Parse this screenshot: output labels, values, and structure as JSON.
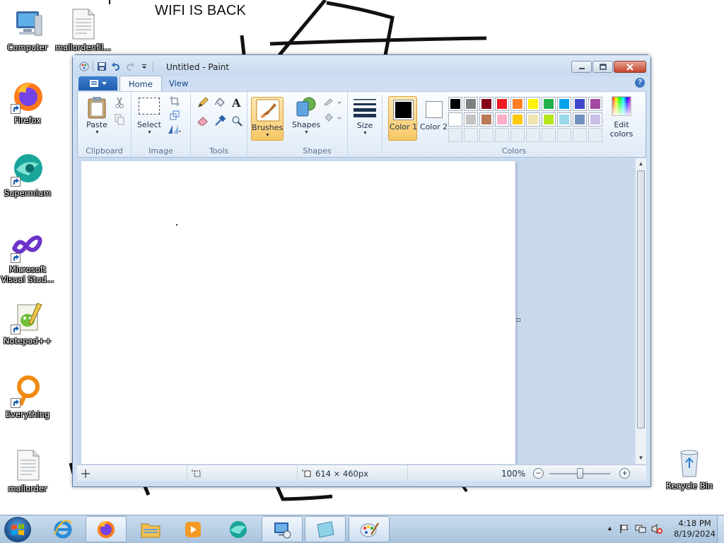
{
  "desktop": {
    "title_text": "WIFI IS BACK",
    "icons": [
      {
        "label": "Computer"
      },
      {
        "label": "mallordenfil..."
      },
      {
        "label": "Firefox"
      },
      {
        "label": "Supermium"
      },
      {
        "label": "Microsoft Visual Stud..."
      },
      {
        "label": "Notepad++"
      },
      {
        "label": "Everything"
      },
      {
        "label": "mallorder"
      },
      {
        "label": "Recycle Bin"
      }
    ]
  },
  "window": {
    "title": "Untitled - Paint",
    "tabs": [
      {
        "label": "Home",
        "active": true
      },
      {
        "label": "View",
        "active": false
      }
    ],
    "groups": {
      "clipboard": {
        "label": "Clipboard",
        "paste_label": "Paste"
      },
      "image": {
        "label": "Image",
        "select_label": "Select"
      },
      "tools": {
        "label": "Tools"
      },
      "brushes": {
        "label": "Brushes"
      },
      "shapes": {
        "label": "Shapes",
        "shapes_label": "Shapes"
      },
      "size": {
        "label": "Size"
      },
      "colors": {
        "label": "Colors",
        "color1_label": "Color 1",
        "color2_label": "Color 2",
        "edit_label": "Edit colors",
        "color1": "#000000",
        "color2": "#ffffff",
        "palette": [
          "#000000",
          "#7f7f7f",
          "#880015",
          "#ed1c24",
          "#ff7f27",
          "#fff200",
          "#22b14c",
          "#00a2e8",
          "#3f48cc",
          "#a349a4",
          "#ffffff",
          "#c3c3c3",
          "#b97a57",
          "#ffaec9",
          "#ffc90e",
          "#efe4b0",
          "#b5e61d",
          "#99d9ea",
          "#7092be",
          "#c8bfe7"
        ]
      }
    },
    "status": {
      "image_size": "614 × 460px",
      "zoom": "100%",
      "zoom_level_fraction": 0.5
    }
  },
  "taskbar": {
    "time": "4:18 PM",
    "date": "8/19/2024"
  }
}
